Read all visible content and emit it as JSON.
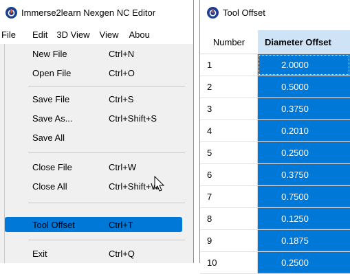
{
  "editor": {
    "title": "Immerse2learn Nexgen NC Editor",
    "menubar": [
      "File",
      "Edit",
      "3D View",
      "View",
      "Abou"
    ]
  },
  "file_menu": {
    "items": [
      {
        "label": "New File",
        "shortcut": "Ctrl+N"
      },
      {
        "label": "Open File",
        "shortcut": "Ctrl+O"
      },
      {
        "label": "Save File",
        "shortcut": "Ctrl+S"
      },
      {
        "label": "Save As...",
        "shortcut": "Ctrl+Shift+S"
      },
      {
        "label": "Save All",
        "shortcut": ""
      },
      {
        "label": "Close File",
        "shortcut": "Ctrl+W"
      },
      {
        "label": "Close All",
        "shortcut": "Ctrl+Shift+W"
      },
      {
        "label": "Tool Offset",
        "shortcut": "Ctrl+T"
      },
      {
        "label": "Exit",
        "shortcut": "Ctrl+Q"
      }
    ]
  },
  "tool_offset": {
    "title": "Tool Offset",
    "columns": [
      "Number",
      "Diameter Offset"
    ],
    "rows": [
      {
        "number": "1",
        "diameter": "2.0000"
      },
      {
        "number": "2",
        "diameter": "0.5000"
      },
      {
        "number": "3",
        "diameter": "0.3750"
      },
      {
        "number": "4",
        "diameter": "0.2010"
      },
      {
        "number": "5",
        "diameter": "0.2500"
      },
      {
        "number": "6",
        "diameter": "0.3750"
      },
      {
        "number": "7",
        "diameter": "0.7500"
      },
      {
        "number": "8",
        "diameter": "0.1250"
      },
      {
        "number": "9",
        "diameter": "0.1875"
      },
      {
        "number": "10",
        "diameter": "0.2500"
      }
    ]
  },
  "colors": {
    "selection": "#0078d7",
    "header_highlight": "#cfe3f7",
    "menu_background": "#f0f0f0",
    "app_icon": "#1e3f8f"
  }
}
